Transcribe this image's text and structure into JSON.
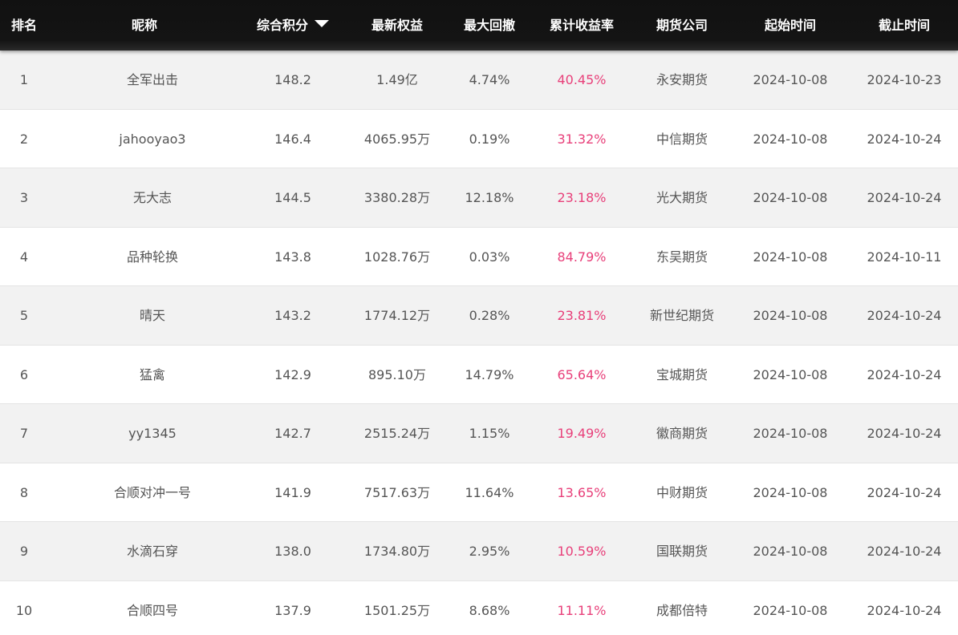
{
  "columns": {
    "rank": "排名",
    "nickname": "昵称",
    "score": "综合积分",
    "equity": "最新权益",
    "drawdown": "最大回撤",
    "return": "累计收益率",
    "company": "期货公司",
    "start": "起始时间",
    "end": "截止时间"
  },
  "sort": {
    "column": "score",
    "direction": "desc",
    "icon": "caret-down-icon"
  },
  "colors": {
    "header_bg": "#141414",
    "odd_row": "#f2f2f2",
    "return_text": "#e8407a",
    "body_text": "#555555"
  },
  "rows": [
    {
      "rank": "1",
      "nickname": "全军出击",
      "score": "148.2",
      "equity": "1.49亿",
      "drawdown": "4.74%",
      "return": "40.45%",
      "company": "永安期货",
      "start": "2024-10-08",
      "end": "2024-10-23"
    },
    {
      "rank": "2",
      "nickname": "jahooyao3",
      "score": "146.4",
      "equity": "4065.95万",
      "drawdown": "0.19%",
      "return": "31.32%",
      "company": "中信期货",
      "start": "2024-10-08",
      "end": "2024-10-24"
    },
    {
      "rank": "3",
      "nickname": "无大志",
      "score": "144.5",
      "equity": "3380.28万",
      "drawdown": "12.18%",
      "return": "23.18%",
      "company": "光大期货",
      "start": "2024-10-08",
      "end": "2024-10-24"
    },
    {
      "rank": "4",
      "nickname": "品种轮换",
      "score": "143.8",
      "equity": "1028.76万",
      "drawdown": "0.03%",
      "return": "84.79%",
      "company": "东吴期货",
      "start": "2024-10-08",
      "end": "2024-10-11"
    },
    {
      "rank": "5",
      "nickname": "晴天",
      "score": "143.2",
      "equity": "1774.12万",
      "drawdown": "0.28%",
      "return": "23.81%",
      "company": "新世纪期货",
      "start": "2024-10-08",
      "end": "2024-10-24"
    },
    {
      "rank": "6",
      "nickname": "猛禽",
      "score": "142.9",
      "equity": "895.10万",
      "drawdown": "14.79%",
      "return": "65.64%",
      "company": "宝城期货",
      "start": "2024-10-08",
      "end": "2024-10-24"
    },
    {
      "rank": "7",
      "nickname": "yy1345",
      "score": "142.7",
      "equity": "2515.24万",
      "drawdown": "1.15%",
      "return": "19.49%",
      "company": "徽商期货",
      "start": "2024-10-08",
      "end": "2024-10-24"
    },
    {
      "rank": "8",
      "nickname": "合顺对冲一号",
      "score": "141.9",
      "equity": "7517.63万",
      "drawdown": "11.64%",
      "return": "13.65%",
      "company": "中财期货",
      "start": "2024-10-08",
      "end": "2024-10-24"
    },
    {
      "rank": "9",
      "nickname": "水滴石穿",
      "score": "138.0",
      "equity": "1734.80万",
      "drawdown": "2.95%",
      "return": "10.59%",
      "company": "国联期货",
      "start": "2024-10-08",
      "end": "2024-10-24"
    },
    {
      "rank": "10",
      "nickname": "合顺四号",
      "score": "137.9",
      "equity": "1501.25万",
      "drawdown": "8.68%",
      "return": "11.11%",
      "company": "成都倍特",
      "start": "2024-10-08",
      "end": "2024-10-24"
    }
  ]
}
